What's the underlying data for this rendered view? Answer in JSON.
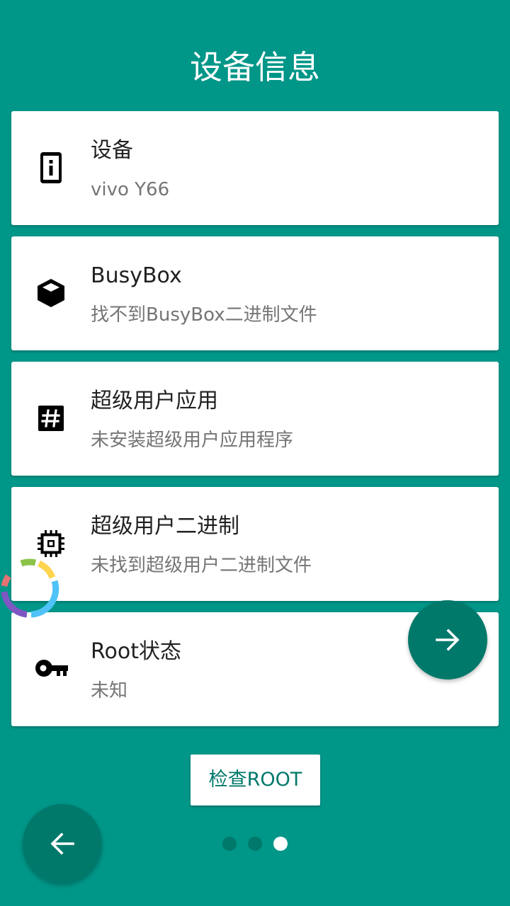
{
  "header": {
    "title": "设备信息"
  },
  "cards": [
    {
      "title": "设备",
      "subtitle": "vivo Y66",
      "icon": "phone-info-icon"
    },
    {
      "title": "BusyBox",
      "subtitle": "找不到BusyBox二进制文件",
      "icon": "box-icon"
    },
    {
      "title": "超级用户应用",
      "subtitle": "未安装超级用户应用程序",
      "icon": "hash-icon"
    },
    {
      "title": "超级用户二进制",
      "subtitle": "未找到超级用户二进制文件",
      "icon": "chip-icon"
    },
    {
      "title": "Root状态",
      "subtitle": "未知",
      "icon": "key-icon"
    }
  ],
  "actions": {
    "check_root_label": "检查ROOT"
  },
  "pager": {
    "count": 3,
    "active_index": 2
  },
  "colors": {
    "background": "#009688",
    "fab": "#00796b",
    "card": "#ffffff"
  }
}
